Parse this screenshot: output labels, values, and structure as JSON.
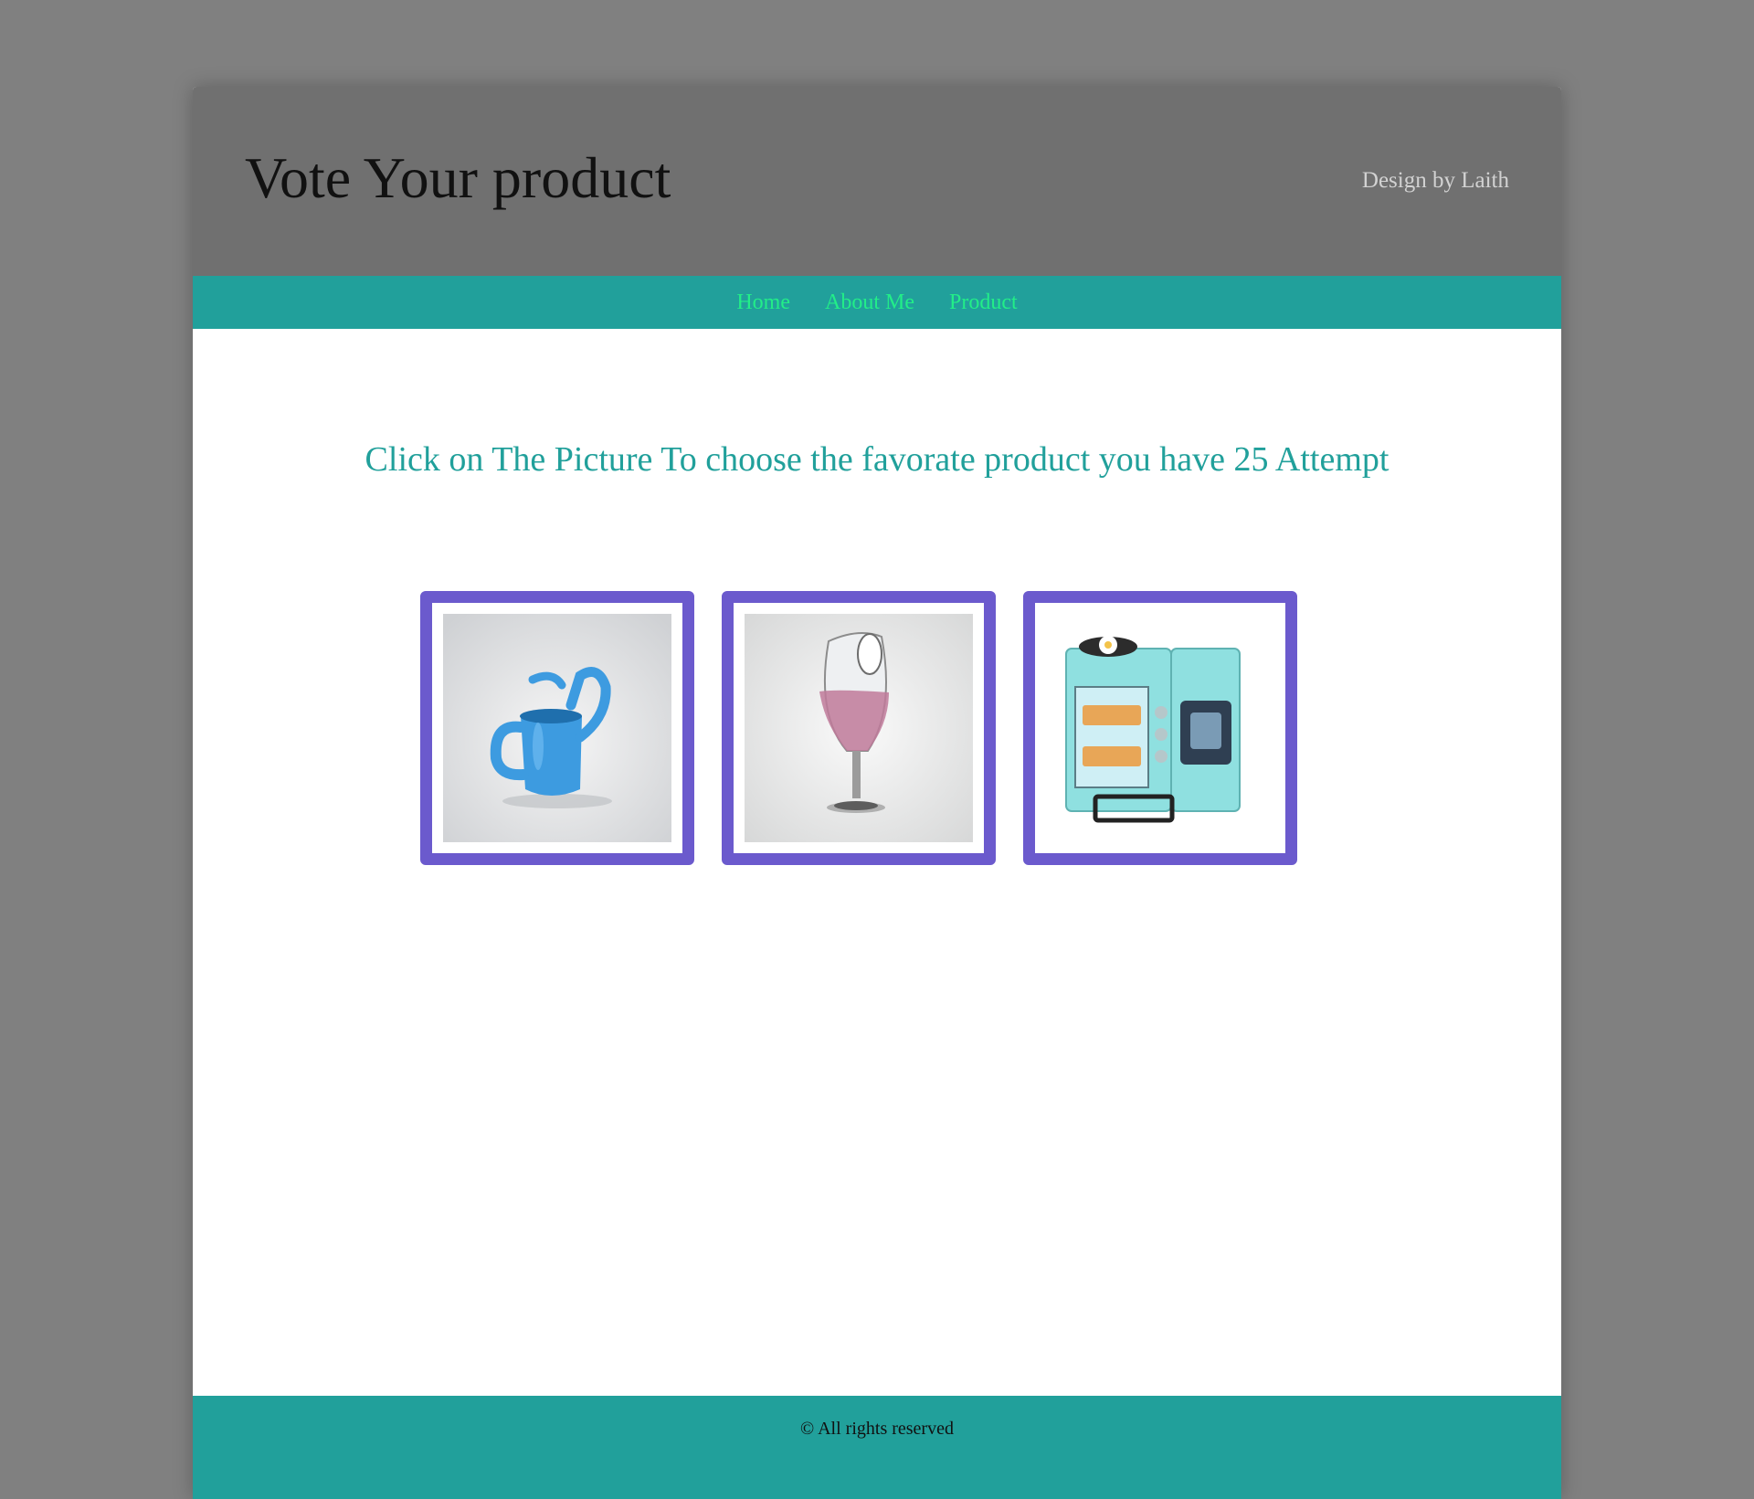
{
  "header": {
    "title": "Vote Your product",
    "credit": "Design by Laith"
  },
  "nav": {
    "items": [
      {
        "label": "Home"
      },
      {
        "label": "About Me"
      },
      {
        "label": "Product"
      }
    ]
  },
  "main": {
    "instructions": "Click on The Picture To choose the favorate product you have 25 Attempt",
    "products": [
      {
        "icon": "watering-can-icon",
        "color": "#3d9be0"
      },
      {
        "icon": "wine-glass-icon",
        "color": "#c07a9a"
      },
      {
        "icon": "breakfast-station-icon",
        "color": "#8fe0e0"
      }
    ]
  },
  "footer": {
    "copyright": "© All rights reserved"
  },
  "colors": {
    "header_bg": "#707070",
    "nav_bg": "#21a09b",
    "nav_link": "#22ee88",
    "card_border": "#6b5acd",
    "footer_bg": "#21a09b"
  }
}
